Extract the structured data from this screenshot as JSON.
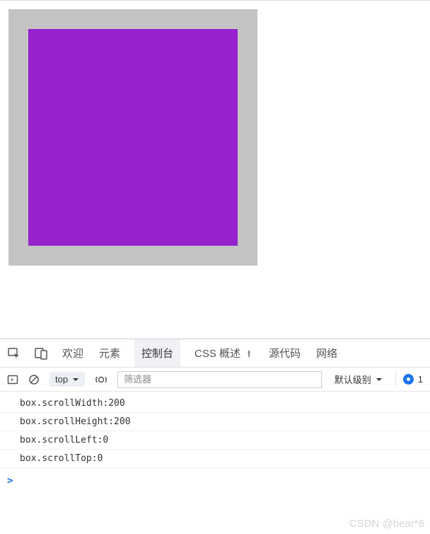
{
  "page": {
    "outer_color": "#c3c3c3",
    "inner_color": "#9522cd"
  },
  "devtools": {
    "tabs": {
      "welcome": "欢迎",
      "elements": "元素",
      "console": "控制台",
      "css_overview": "CSS 概述",
      "sources": "源代码",
      "network": "网络"
    },
    "toolbar": {
      "context": "top",
      "filter_placeholder": "筛选器",
      "level": "默认级别",
      "issues_count": "1"
    },
    "console": {
      "lines": [
        "box.scrollWidth:200",
        "box.scrollHeight:200",
        "box.scrollLeft:0",
        "box.scrollTop:0"
      ],
      "prompt": ">"
    }
  },
  "watermark": "CSDN @bear*6"
}
